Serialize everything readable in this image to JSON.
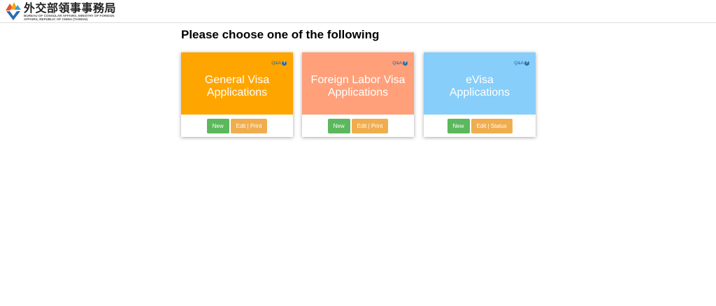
{
  "header": {
    "logo_title": "外交部領事事務局",
    "logo_subtitle_line1": "BUREAU OF CONSULAR AFFAIRS, MINISTRY OF FOREIGN",
    "logo_subtitle_line2": "AFFAIRS, REPUBLIC OF CHINA (TAIWAN)"
  },
  "main": {
    "title": "Please choose one of the following"
  },
  "cards": [
    {
      "qa_label": "Q&A",
      "title_line1": "General Visa",
      "title_line2": "Applications",
      "color": "#ffa500",
      "new_label": "New",
      "edit_label": "Edit | Print"
    },
    {
      "qa_label": "Q&A",
      "title_line1": "Foreign Labor Visa",
      "title_line2": "Applications",
      "color": "#ffa07a",
      "new_label": "New",
      "edit_label": "Edit | Print"
    },
    {
      "qa_label": "Q&A",
      "title_line1": "eVisa",
      "title_line2": "Applications",
      "color": "#87cefa",
      "new_label": "New",
      "edit_label": "Edit | Status"
    }
  ],
  "colors": {
    "new_button": "#5cb85c",
    "edit_button": "#f0ad4e",
    "qa_link": "#1f5fa8"
  },
  "icons": {
    "logo": "bureau-logo-icon",
    "qa": "question-circle-icon"
  }
}
